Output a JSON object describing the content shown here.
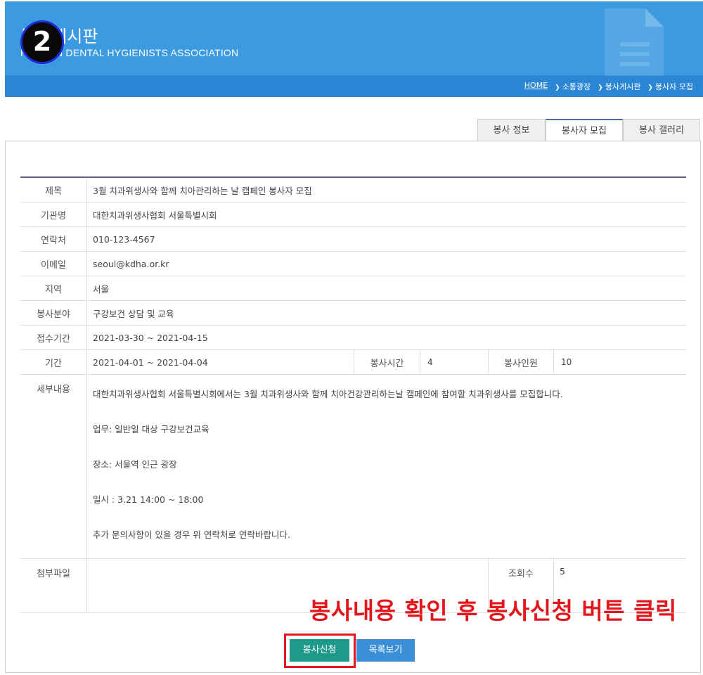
{
  "header": {
    "title": "봉사게시판",
    "subtitle": "KOREAN DENTAL HYGIENISTS ASSOCIATION",
    "step_badge": "2",
    "colors": {
      "banner": "#3b9ae0",
      "strip": "#2b86d4"
    }
  },
  "breadcrumb": {
    "home": "HOME",
    "items": [
      "소통광장",
      "봉사게시판",
      "봉사자 모집"
    ]
  },
  "tabs": [
    {
      "label": "봉사 정보",
      "active": false
    },
    {
      "label": "봉사자 모집",
      "active": true
    },
    {
      "label": "봉사 갤러리",
      "active": false
    }
  ],
  "detail": {
    "title_label": "제목",
    "title_value": "3월 치과위생사와 함께 치아관리하는 날 캠페인 봉사자 모집",
    "org_label": "기관명",
    "org_value": "대한치과위생사협회 서울특별시회",
    "contact_label": "연락처",
    "contact_value": "010-123-4567",
    "email_label": "이메일",
    "email_value": "seoul@kdha.or.kr",
    "region_label": "지역",
    "region_value": "서울",
    "field_label": "봉사분야",
    "field_value": "구강보건 상담 및 교육",
    "apply_period_label": "접수기간",
    "apply_period_value": "2021-03-30 ~ 2021-04-15",
    "period_label": "기간",
    "period_value": "2021-04-01 ~ 2021-04-04",
    "hours_label": "봉사시간",
    "hours_value": "4",
    "people_label": "봉사인원",
    "people_value": "10",
    "content_label": "세부내용",
    "content_lines": [
      "대한치과위생사협회 서울특별시회에서는 3월 치과위생사와 함께 치아건강관리하는날 캠페인에 참여할 치과위생사를 모집합니다.",
      "업무: 일반일 대상 구강보건교육",
      "장소: 서울역 인근 광장",
      "일시 : 3.21 14:00 ~ 18:00",
      "추가 문의사항이 있을 경우 위 연락처로 연락바랍니다."
    ],
    "attach_label": "첨부파일",
    "views_label": "조회수",
    "views_value": "5"
  },
  "annotation": "봉사내용 확인 후 봉사신청 버튼 클릭",
  "buttons": {
    "apply": "봉사신청",
    "list": "목록보기"
  }
}
